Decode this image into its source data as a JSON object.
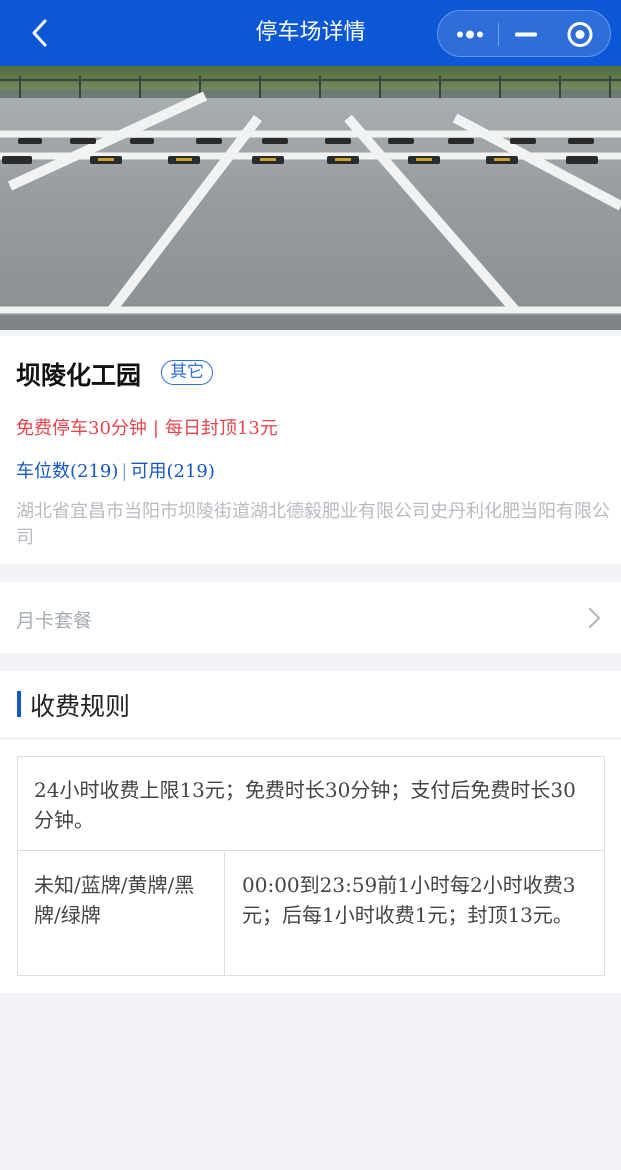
{
  "nav": {
    "title": "停车场详情",
    "back_icon": "chevron-left-icon",
    "capsule_icons": [
      "more-dots-icon",
      "minimize-icon",
      "target-icon"
    ],
    "bar_color": "#0b57d6"
  },
  "lot": {
    "name": "坝陵化工园",
    "tag": "其它",
    "free_parking": "免费停车30分钟",
    "daily_cap": "每日封顶13元",
    "spaces": "车位数(219)",
    "available": "可用(219)",
    "address": "湖北省宜昌市当阳市坝陵街道湖北德毅肥业有限公司史丹利化肥当阳有限公司",
    "price_color": "#e5454a",
    "space_color": "#1657c8"
  },
  "monthly": {
    "label": "月卡套餐",
    "chevron_icon": "chevron-right-icon"
  },
  "rules": {
    "title": "收费规则",
    "summary": "24小时收费上限13元；免费时长30分钟；支付后免费时长30分钟。",
    "plate_types": "未知/蓝牌/黄牌/黑牌/绿牌",
    "detail": "00:00到23:59前1小时每2小时收费3元；后每1小时收费1元；封顶13元。"
  }
}
